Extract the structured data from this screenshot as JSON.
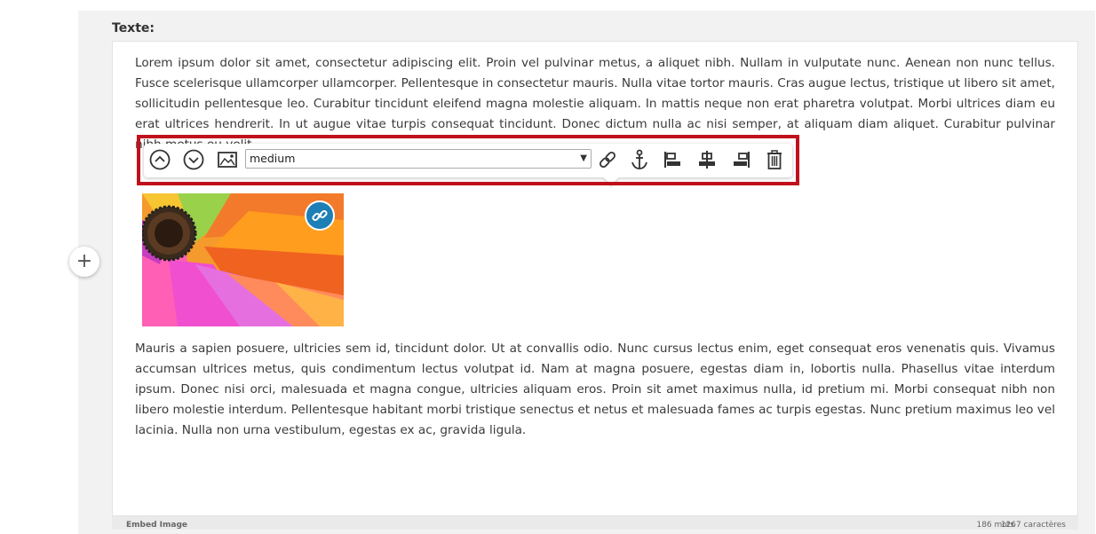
{
  "field": {
    "label": "Texte:"
  },
  "paragraphs": {
    "p1": "Lorem ipsum dolor sit amet, consectetur adipiscing elit. Proin vel pulvinar metus, a aliquet nibh. Nullam in vulputate nunc. Aenean non nunc tellus. Fusce scelerisque ullamcorper ullamcorper. Pellentesque in consectetur mauris. Nulla vitae tortor mauris. Cras augue lectus, tristique ut libero sit amet, sollicitudin pellentesque leo. Curabitur tincidunt eleifend magna molestie aliquam. In mattis neque non erat pharetra volutpat. Morbi ultrices diam eu erat ultrices hendrerit. In ut augue vitae turpis consequat tincidunt. Donec dictum nulla ac nisi semper, at aliquam diam aliquet. Curabitur pulvinar nibh metus eu velit.",
    "p2": "Mauris a sapien posuere, ultricies sem id, tincidunt dolor. Ut at convallis odio. Nunc cursus lectus enim, eget consequat eros venenatis quis. Vivamus accumsan ultrices metus, quis condimentum lectus volutpat id. Nam at magna posuere, egestas diam in, lobortis nulla. Phasellus vitae interdum ipsum. Donec nisi orci, malesuada et magna congue, ultricies aliquam eros. Proin sit amet maximus nulla, id pretium mi. Morbi consequat nibh non libero molestie interdum. Pellentesque habitant morbi tristique senectus et netus et malesuada fames ac turpis egestas. Nunc pretium maximus leo vel lacinia. Nulla non urna vestibulum, egestas ex ac, gravida ligula."
  },
  "toolbar": {
    "size_value": "medium",
    "icons": [
      "move-up-icon",
      "move-down-icon",
      "image-icon",
      "link-icon",
      "anchor-icon",
      "align-left-icon",
      "align-center-icon",
      "align-right-icon",
      "delete-icon"
    ]
  },
  "add_button": {
    "label": "+"
  },
  "statusbar": {
    "left": "Embed Image",
    "words": "186 mots",
    "chars": "1267 caractères"
  },
  "colors": {
    "highlight": "#c0111b",
    "link_badge": "#1d7fb6"
  }
}
